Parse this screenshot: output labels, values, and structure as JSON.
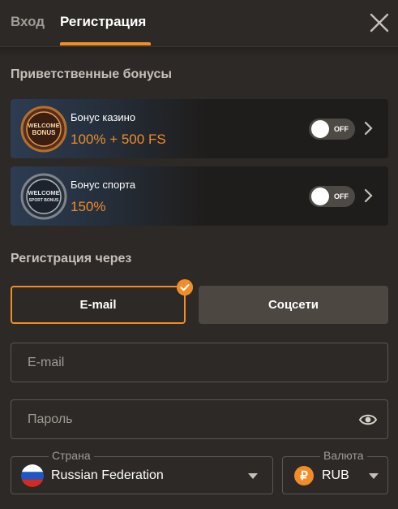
{
  "tabs": {
    "login": "Вход",
    "register": "Регистрация"
  },
  "welcome": {
    "title": "Приветственные бонусы"
  },
  "bonuses": [
    {
      "name": "Бонус казино",
      "value": "100% + 500 FS",
      "toggle": "OFF",
      "badge_text_1": "WELCOME",
      "badge_text_2": "BONUS"
    },
    {
      "name": "Бонус спорта",
      "value": "150%",
      "toggle": "OFF",
      "badge_text_1": "WELCOME",
      "badge_text_2": "SPORT BONUS"
    }
  ],
  "registration": {
    "title": "Регистрация через",
    "email_label": "E-mail",
    "social_label": "Соцсети"
  },
  "fields": {
    "email_placeholder": "E-mail",
    "password_placeholder": "Пароль"
  },
  "country": {
    "legend": "Страна",
    "value": "Russian Federation"
  },
  "currency": {
    "legend": "Валюта",
    "value": "RUB",
    "symbol": "₽"
  },
  "colors": {
    "accent": "#f28c28",
    "background": "#2c2926"
  }
}
